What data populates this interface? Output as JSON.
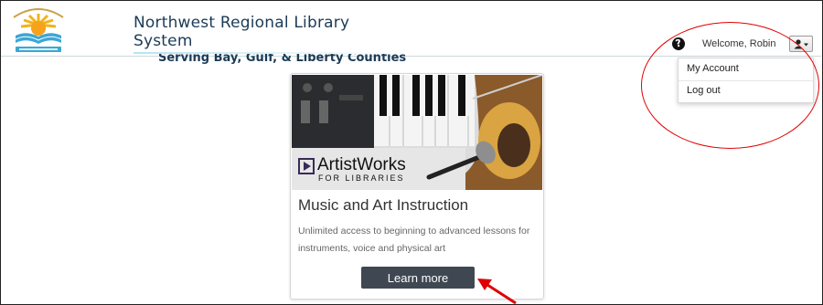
{
  "header": {
    "org_title": "Northwest Regional Library System",
    "org_subtitle": "Serving Bay, Gulf, & Liberty Counties",
    "logo_icon": "library-sun-logo-icon",
    "help_icon": "help-circle-icon",
    "help_glyph": "?",
    "welcome_text": "Welcome, Robin",
    "user_icon": "user-menu-icon"
  },
  "user_menu": {
    "items": [
      {
        "label": "My Account"
      },
      {
        "label": "Log out"
      }
    ]
  },
  "card": {
    "image_icon": "artistworks-banner-image",
    "image_brand": "ArtistWorks",
    "image_brand_sub": "FOR LIBRARIES",
    "title": "Music and Art Instruction",
    "description": "Unlimited access to beginning to advanced lessons for instruments, voice and physical art",
    "button_label": "Learn more"
  },
  "annotations": {
    "highlight_color": "#e00000",
    "arrow_icon": "red-arrow-icon"
  }
}
